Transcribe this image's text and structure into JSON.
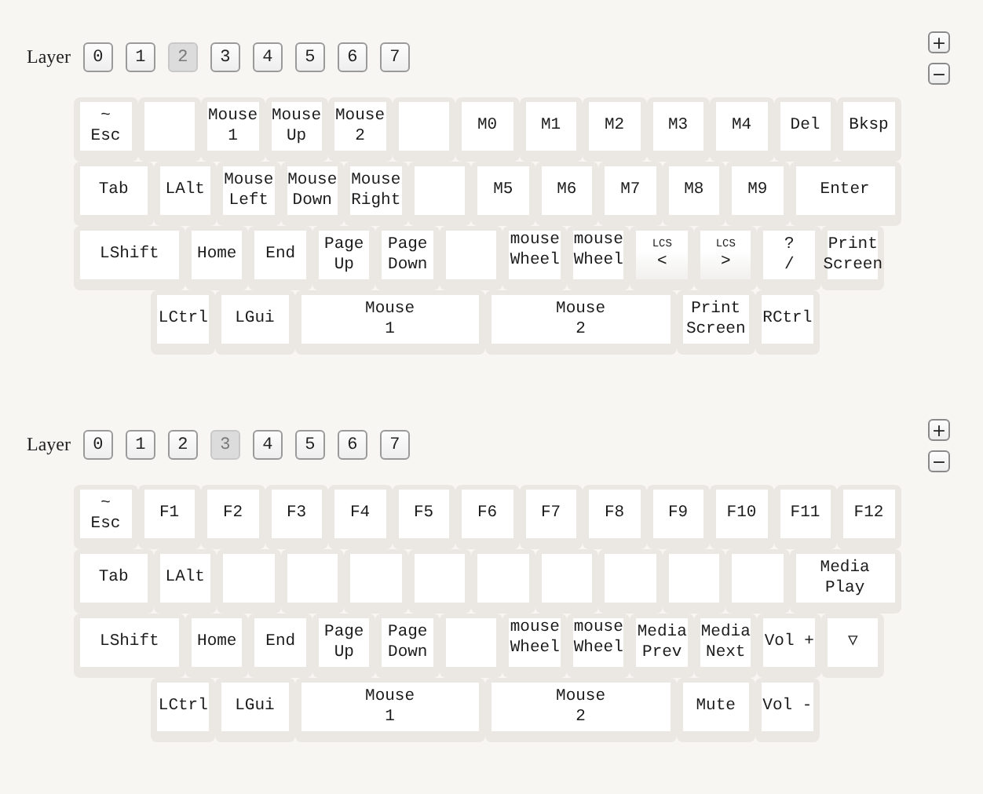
{
  "panels": [
    {
      "layer_label": "Layer",
      "zoom_in": "+",
      "zoom_out": "−",
      "layers": [
        {
          "label": "0",
          "selected": false
        },
        {
          "label": "1",
          "selected": false
        },
        {
          "label": "2",
          "selected": true
        },
        {
          "label": "3",
          "selected": false
        },
        {
          "label": "4",
          "selected": false
        },
        {
          "label": "5",
          "selected": false
        },
        {
          "label": "6",
          "selected": false
        },
        {
          "label": "7",
          "selected": false
        }
      ],
      "keyboard": [
        [
          {
            "kind": "plain",
            "legend": [
              "~",
              "Esc"
            ]
          },
          {
            "kind": "blank"
          },
          {
            "kind": "plain",
            "legend": [
              "Mouse",
              "1"
            ]
          },
          {
            "kind": "plain",
            "legend": [
              "Mouse",
              "Up"
            ]
          },
          {
            "kind": "plain",
            "legend": [
              "Mouse",
              "2"
            ]
          },
          {
            "kind": "blank"
          },
          {
            "kind": "plain",
            "legend": [
              "M0"
            ]
          },
          {
            "kind": "plain",
            "legend": [
              "M1"
            ]
          },
          {
            "kind": "plain",
            "legend": [
              "M2"
            ]
          },
          {
            "kind": "plain",
            "legend": [
              "M3"
            ]
          },
          {
            "kind": "plain",
            "legend": [
              "M4"
            ]
          },
          {
            "kind": "plain",
            "legend": [
              "Del"
            ]
          },
          {
            "kind": "plain",
            "legend": [
              "Bksp"
            ]
          }
        ],
        [
          {
            "kind": "plain",
            "legend": [
              "Tab"
            ]
          },
          {
            "kind": "plain",
            "legend": [
              "LAlt"
            ]
          },
          {
            "kind": "plain",
            "legend": [
              "Mouse",
              "Left"
            ]
          },
          {
            "kind": "plain",
            "legend": [
              "Mouse",
              "Down"
            ]
          },
          {
            "kind": "plain",
            "legend": [
              "Mouse",
              "Right"
            ]
          },
          {
            "kind": "blank"
          },
          {
            "kind": "plain",
            "legend": [
              "M5"
            ]
          },
          {
            "kind": "plain",
            "legend": [
              "M6"
            ]
          },
          {
            "kind": "plain",
            "legend": [
              "M7"
            ]
          },
          {
            "kind": "plain",
            "legend": [
              "M8"
            ]
          },
          {
            "kind": "plain",
            "legend": [
              "M9"
            ]
          },
          {
            "kind": "plain",
            "legend": [
              "Enter"
            ]
          }
        ],
        [
          {
            "kind": "plain",
            "legend": [
              "LShift"
            ]
          },
          {
            "kind": "plain",
            "legend": [
              "Home"
            ]
          },
          {
            "kind": "plain",
            "legend": [
              "End"
            ]
          },
          {
            "kind": "plain",
            "legend": [
              "Page",
              "Up"
            ]
          },
          {
            "kind": "plain",
            "legend": [
              "Page",
              "Down"
            ]
          },
          {
            "kind": "blank"
          },
          {
            "kind": "clipped",
            "legend": [
              "mouse",
              "Wheel"
            ]
          },
          {
            "kind": "clipped",
            "legend": [
              "mouse",
              "Wheel"
            ]
          },
          {
            "kind": "lcs",
            "tag": "LCS",
            "legend": [
              "<"
            ]
          },
          {
            "kind": "lcs",
            "tag": "LCS",
            "legend": [
              ">"
            ]
          },
          {
            "kind": "plain",
            "legend": [
              "?",
              "/"
            ]
          },
          {
            "kind": "plain",
            "legend": [
              "Print",
              "Screen"
            ]
          }
        ],
        [
          {
            "kind": "plain",
            "legend": [
              "LCtrl"
            ]
          },
          {
            "kind": "plain",
            "legend": [
              "LGui"
            ]
          },
          {
            "kind": "plain",
            "legend": [
              "Mouse",
              "1"
            ]
          },
          {
            "kind": "plain",
            "legend": [
              "Mouse",
              "2"
            ]
          },
          {
            "kind": "plain",
            "legend": [
              "Print",
              "Screen"
            ]
          },
          {
            "kind": "plain",
            "legend": [
              "RCtrl"
            ]
          }
        ]
      ]
    },
    {
      "layer_label": "Layer",
      "zoom_in": "+",
      "zoom_out": "−",
      "layers": [
        {
          "label": "0",
          "selected": false
        },
        {
          "label": "1",
          "selected": false
        },
        {
          "label": "2",
          "selected": false
        },
        {
          "label": "3",
          "selected": true
        },
        {
          "label": "4",
          "selected": false
        },
        {
          "label": "5",
          "selected": false
        },
        {
          "label": "6",
          "selected": false
        },
        {
          "label": "7",
          "selected": false
        }
      ],
      "keyboard": [
        [
          {
            "kind": "plain",
            "legend": [
              "~",
              "Esc"
            ]
          },
          {
            "kind": "plain",
            "legend": [
              "F1"
            ]
          },
          {
            "kind": "plain",
            "legend": [
              "F2"
            ]
          },
          {
            "kind": "plain",
            "legend": [
              "F3"
            ]
          },
          {
            "kind": "plain",
            "legend": [
              "F4"
            ]
          },
          {
            "kind": "plain",
            "legend": [
              "F5"
            ]
          },
          {
            "kind": "plain",
            "legend": [
              "F6"
            ]
          },
          {
            "kind": "plain",
            "legend": [
              "F7"
            ]
          },
          {
            "kind": "plain",
            "legend": [
              "F8"
            ]
          },
          {
            "kind": "plain",
            "legend": [
              "F9"
            ]
          },
          {
            "kind": "plain",
            "legend": [
              "F10"
            ]
          },
          {
            "kind": "plain",
            "legend": [
              "F11"
            ]
          },
          {
            "kind": "plain",
            "legend": [
              "F12"
            ]
          }
        ],
        [
          {
            "kind": "plain",
            "legend": [
              "Tab"
            ]
          },
          {
            "kind": "plain",
            "legend": [
              "LAlt"
            ]
          },
          {
            "kind": "blank"
          },
          {
            "kind": "blank"
          },
          {
            "kind": "blank"
          },
          {
            "kind": "blank"
          },
          {
            "kind": "blank"
          },
          {
            "kind": "blank"
          },
          {
            "kind": "blank"
          },
          {
            "kind": "blank"
          },
          {
            "kind": "blank"
          },
          {
            "kind": "plain",
            "legend": [
              "Media",
              "Play"
            ]
          }
        ],
        [
          {
            "kind": "plain",
            "legend": [
              "LShift"
            ]
          },
          {
            "kind": "plain",
            "legend": [
              "Home"
            ]
          },
          {
            "kind": "plain",
            "legend": [
              "End"
            ]
          },
          {
            "kind": "plain",
            "legend": [
              "Page",
              "Up"
            ]
          },
          {
            "kind": "plain",
            "legend": [
              "Page",
              "Down"
            ]
          },
          {
            "kind": "blank"
          },
          {
            "kind": "clipped",
            "legend": [
              "mouse",
              "Wheel"
            ]
          },
          {
            "kind": "clipped",
            "legend": [
              "mouse",
              "Wheel"
            ]
          },
          {
            "kind": "plain",
            "legend": [
              "Media",
              "Prev"
            ]
          },
          {
            "kind": "plain",
            "legend": [
              "Media",
              "Next"
            ]
          },
          {
            "kind": "plain",
            "legend": [
              "Vol +"
            ]
          },
          {
            "kind": "plain",
            "legend": [
              "▽"
            ]
          }
        ],
        [
          {
            "kind": "plain",
            "legend": [
              "LCtrl"
            ]
          },
          {
            "kind": "plain",
            "legend": [
              "LGui"
            ]
          },
          {
            "kind": "plain",
            "legend": [
              "Mouse",
              "1"
            ]
          },
          {
            "kind": "plain",
            "legend": [
              "Mouse",
              "2"
            ]
          },
          {
            "kind": "plain",
            "legend": [
              "Mute"
            ]
          },
          {
            "kind": "plain",
            "legend": [
              "Vol -"
            ]
          }
        ]
      ]
    }
  ]
}
